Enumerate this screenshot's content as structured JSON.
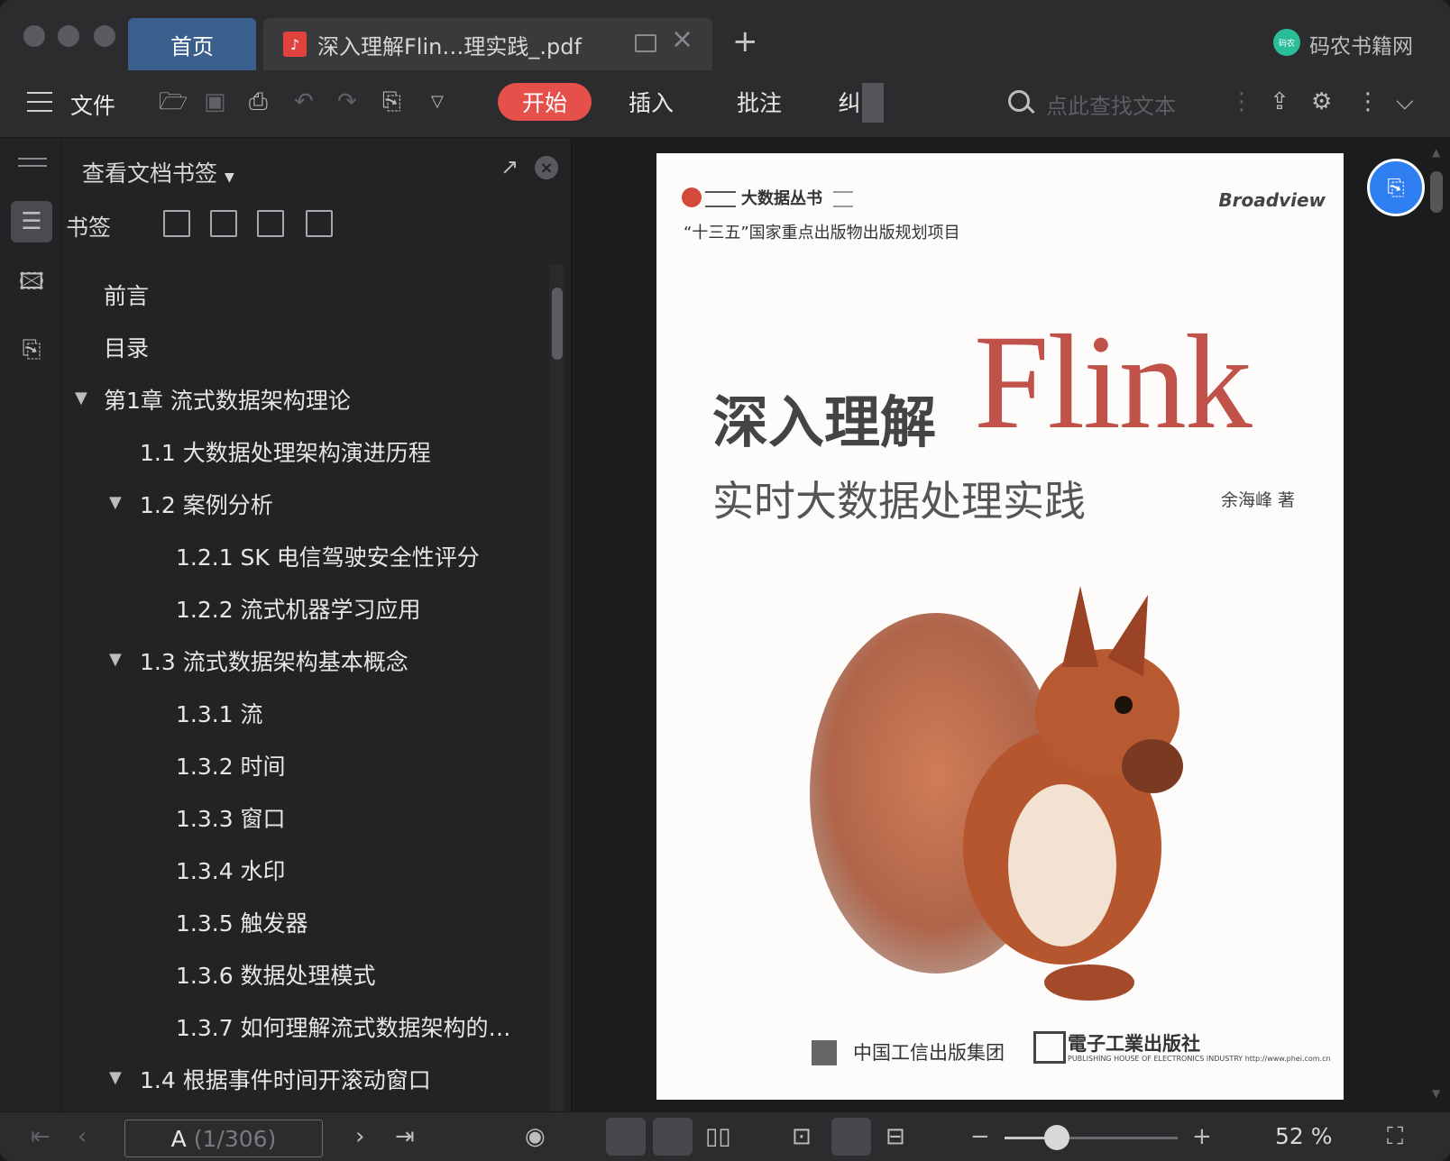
{
  "tabs": {
    "home": "首页",
    "document": "深入理解Flin…理实践_.pdf",
    "site_logo_text": "码农",
    "site_name": "码农书籍网"
  },
  "toolbar": {
    "file": "文件",
    "tabs": [
      "开始",
      "插入",
      "批注",
      "纠"
    ],
    "search_placeholder": "点此查找文本"
  },
  "panel": {
    "title": "查看文档书签",
    "bookmarks_label": "书签",
    "items": [
      {
        "text": "前言",
        "caret": ""
      },
      {
        "text": "目录",
        "caret": ""
      },
      {
        "text": "第1章  流式数据架构理论",
        "caret": "▼"
      },
      {
        "text": "1.1 大数据处理架构演进历程",
        "caret": ""
      },
      {
        "text": "1.2 案例分析",
        "caret": "▼"
      },
      {
        "text": "1.2.1 SK 电信驾驶安全性评分",
        "caret": ""
      },
      {
        "text": "1.2.2 流式机器学习应用",
        "caret": ""
      },
      {
        "text": "1.3 流式数据架构基本概念",
        "caret": "▼"
      },
      {
        "text": "1.3.1 流",
        "caret": ""
      },
      {
        "text": "1.3.2 时间",
        "caret": ""
      },
      {
        "text": "1.3.3 窗口",
        "caret": ""
      },
      {
        "text": "1.3.4 水印",
        "caret": ""
      },
      {
        "text": "1.3.5 触发器",
        "caret": ""
      },
      {
        "text": "1.3.6 数据处理模式",
        "caret": ""
      },
      {
        "text": "1.3.7 如何理解流式数据架构的…",
        "caret": ""
      },
      {
        "text": "1.4 根据事件时间开滚动窗口",
        "caret": "▼"
      }
    ]
  },
  "cover": {
    "series": "大数据丛书",
    "publisher_top": "Broadview",
    "plan": "“十三五”国家重点出版物出版规划项目",
    "title_cn": "深入理解",
    "title_en": "Flink",
    "subtitle": "实时大数据处理实践",
    "author": "余海峰  著",
    "publisher_group": "中国工信出版集团",
    "publisher_house": "電子工業出版社",
    "publisher_house_en": "PUBLISHING HOUSE OF ELECTRONICS INDUSTRY  http://www.phei.com.cn"
  },
  "status": {
    "page_label": "A",
    "page_count": "(1/306)",
    "zoom": "52 %",
    "zoom_level": 0.3
  }
}
